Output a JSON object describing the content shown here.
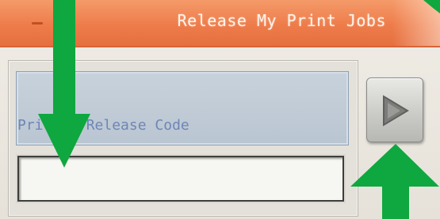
{
  "header": {
    "title": "Release My Print Jobs"
  },
  "form": {
    "code_label": "Privacy Release Code",
    "code_value": "",
    "code_placeholder": ""
  },
  "icons": {
    "next_button_icon": "play-triangle-icon",
    "annotation_arrows": "green-arrow-icon"
  },
  "colors": {
    "header_bg": "#ee7c4a",
    "header_text": "#fff3ea",
    "label_box_bg": "#c1ccd7",
    "label_text": "#6f86b6",
    "annotation_arrow": "#0fa73f"
  }
}
